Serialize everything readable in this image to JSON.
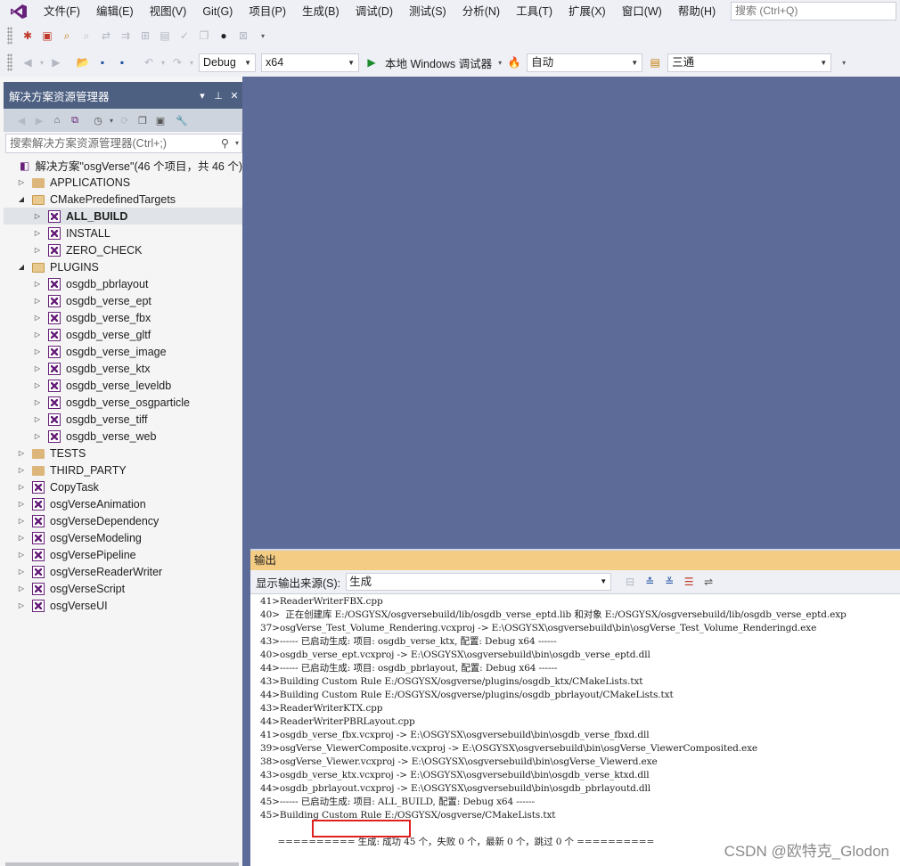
{
  "menubar": {
    "items": [
      "文件(F)",
      "编辑(E)",
      "视图(V)",
      "Git(G)",
      "项目(P)",
      "生成(B)",
      "调试(D)",
      "测试(S)",
      "分析(N)",
      "工具(T)",
      "扩展(X)",
      "窗口(W)",
      "帮助(H)"
    ],
    "search_placeholder": "搜索 (Ctrl+Q)"
  },
  "toolbar": {
    "config": "Debug",
    "platform": "x64",
    "run_label": "本地 Windows 调试器",
    "run_mode": "自动",
    "target": "三通"
  },
  "solution_explorer": {
    "title": "解决方案资源管理器",
    "search_placeholder": "搜索解决方案资源管理器(Ctrl+;)",
    "root": "解决方案\"osgVerse\"(46 个项目，共 46 个)",
    "items": [
      {
        "label": "APPLICATIONS",
        "level": 1,
        "kind": "folder",
        "expanded": false
      },
      {
        "label": "CMakePredefinedTargets",
        "level": 1,
        "kind": "folder",
        "expanded": true
      },
      {
        "label": "ALL_BUILD",
        "level": 2,
        "kind": "project",
        "expanded": false,
        "selected": true
      },
      {
        "label": "INSTALL",
        "level": 2,
        "kind": "project",
        "expanded": false
      },
      {
        "label": "ZERO_CHECK",
        "level": 2,
        "kind": "project",
        "expanded": false
      },
      {
        "label": "PLUGINS",
        "level": 1,
        "kind": "folder",
        "expanded": true
      },
      {
        "label": "osgdb_pbrlayout",
        "level": 2,
        "kind": "project",
        "expanded": false
      },
      {
        "label": "osgdb_verse_ept",
        "level": 2,
        "kind": "project",
        "expanded": false
      },
      {
        "label": "osgdb_verse_fbx",
        "level": 2,
        "kind": "project",
        "expanded": false
      },
      {
        "label": "osgdb_verse_gltf",
        "level": 2,
        "kind": "project",
        "expanded": false
      },
      {
        "label": "osgdb_verse_image",
        "level": 2,
        "kind": "project",
        "expanded": false
      },
      {
        "label": "osgdb_verse_ktx",
        "level": 2,
        "kind": "project",
        "expanded": false
      },
      {
        "label": "osgdb_verse_leveldb",
        "level": 2,
        "kind": "project",
        "expanded": false
      },
      {
        "label": "osgdb_verse_osgparticle",
        "level": 2,
        "kind": "project",
        "expanded": false
      },
      {
        "label": "osgdb_verse_tiff",
        "level": 2,
        "kind": "project",
        "expanded": false
      },
      {
        "label": "osgdb_verse_web",
        "level": 2,
        "kind": "project",
        "expanded": false
      },
      {
        "label": "TESTS",
        "level": 1,
        "kind": "folder",
        "expanded": false
      },
      {
        "label": "THIRD_PARTY",
        "level": 1,
        "kind": "folder",
        "expanded": false
      },
      {
        "label": "CopyTask",
        "level": 1,
        "kind": "project",
        "expanded": false
      },
      {
        "label": "osgVerseAnimation",
        "level": 1,
        "kind": "project",
        "expanded": false
      },
      {
        "label": "osgVerseDependency",
        "level": 1,
        "kind": "project",
        "expanded": false
      },
      {
        "label": "osgVerseModeling",
        "level": 1,
        "kind": "project",
        "expanded": false
      },
      {
        "label": "osgVersePipeline",
        "level": 1,
        "kind": "project",
        "expanded": false
      },
      {
        "label": "osgVerseReaderWriter",
        "level": 1,
        "kind": "project",
        "expanded": false
      },
      {
        "label": "osgVerseScript",
        "level": 1,
        "kind": "project",
        "expanded": false
      },
      {
        "label": "osgVerseUI",
        "level": 1,
        "kind": "project",
        "expanded": false
      }
    ]
  },
  "output": {
    "title": "输出",
    "source_label": "显示输出来源(S):",
    "source_value": "生成",
    "lines": [
      "41>ReaderWriterFBX.cpp",
      "40>  正在创建库 E:/OSGYSX/osgversebuild/lib/osgdb_verse_eptd.lib 和对象 E:/OSGYSX/osgversebuild/lib/osgdb_verse_eptd.exp",
      "37>osgVerse_Test_Volume_Rendering.vcxproj -> E:\\OSGYSX\\osgversebuild\\bin\\osgVerse_Test_Volume_Renderingd.exe",
      "43>------ 已启动生成: 项目: osgdb_verse_ktx, 配置: Debug x64 ------",
      "40>osgdb_verse_ept.vcxproj -> E:\\OSGYSX\\osgversebuild\\bin\\osgdb_verse_eptd.dll",
      "44>------ 已启动生成: 项目: osgdb_pbrlayout, 配置: Debug x64 ------",
      "43>Building Custom Rule E:/OSGYSX/osgverse/plugins/osgdb_ktx/CMakeLists.txt",
      "44>Building Custom Rule E:/OSGYSX/osgverse/plugins/osgdb_pbrlayout/CMakeLists.txt",
      "43>ReaderWriterKTX.cpp",
      "44>ReaderWriterPBRLayout.cpp",
      "41>osgdb_verse_fbx.vcxproj -> E:\\OSGYSX\\osgversebuild\\bin\\osgdb_verse_fbxd.dll",
      "39>osgVerse_ViewerComposite.vcxproj -> E:\\OSGYSX\\osgversebuild\\bin\\osgVerse_ViewerComposited.exe",
      "38>osgVerse_Viewer.vcxproj -> E:\\OSGYSX\\osgversebuild\\bin\\osgVerse_Viewerd.exe",
      "43>osgdb_verse_ktx.vcxproj -> E:\\OSGYSX\\osgversebuild\\bin\\osgdb_verse_ktxd.dll",
      "44>osgdb_pbrlayout.vcxproj -> E:\\OSGYSX\\osgversebuild\\bin\\osgdb_pbrlayoutd.dll",
      "45>------ 已启动生成: 项目: ALL_BUILD, 配置: Debug x64 ------",
      "45>Building Custom Rule E:/OSGYSX/osgverse/CMakeLists.txt"
    ],
    "summary": "========== 生成: 成功 45 个，失败 0 个，最新 0 个，跳过 0 个 =========="
  },
  "watermark": "CSDN @欧特克_Glodon"
}
